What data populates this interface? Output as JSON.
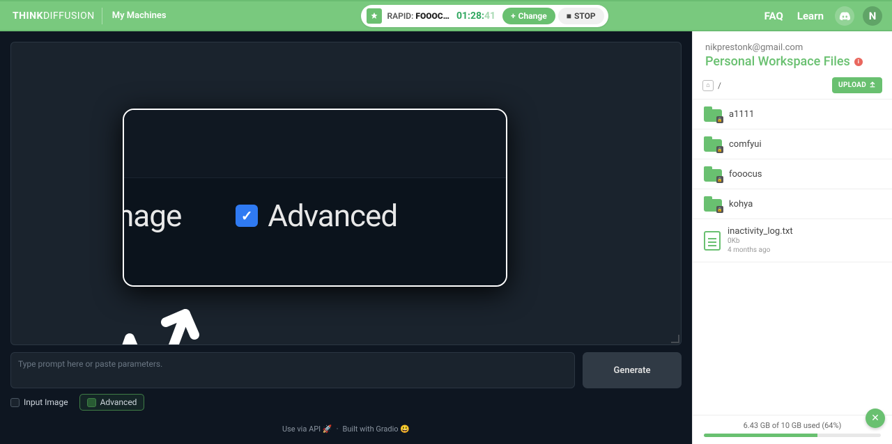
{
  "topbar": {
    "logo_bold": "THINK",
    "logo_light": "DIFFUSION",
    "my_machines": "My Machines",
    "rapid_prefix": "RAPID: ",
    "rapid_name": "FOOOC…",
    "timer_main": "01:28:",
    "timer_sec": "41",
    "change": "Change",
    "stop": "STOP",
    "faq": "FAQ",
    "learn": "Learn",
    "avatar_initial": "N"
  },
  "main": {
    "zoom_image_partial": "nage",
    "zoom_advanced": "Advanced",
    "prompt_placeholder": "Type prompt here or paste parameters.",
    "generate": "Generate",
    "opt_input_image": "Input Image",
    "opt_advanced": "Advanced",
    "footer_api": "Use via API",
    "footer_api_emoji": "🚀",
    "footer_built": "Built with Gradio",
    "footer_built_emoji": "😃",
    "footer_sep": "·"
  },
  "sidebar": {
    "email": "nikprestonk@gmail.com",
    "title": "Personal Workspace Files",
    "crumb": "/",
    "upload": "UPLOAD",
    "folders": [
      {
        "name": "a1111"
      },
      {
        "name": "comfyui"
      },
      {
        "name": "fooocus"
      },
      {
        "name": "kohya"
      }
    ],
    "file": {
      "name": "inactivity_log.txt",
      "size": "0Kb",
      "modified": "4 months ago"
    },
    "storage_text": "6.43 GB of 10 GB used (64%)",
    "storage_pct": 64
  }
}
